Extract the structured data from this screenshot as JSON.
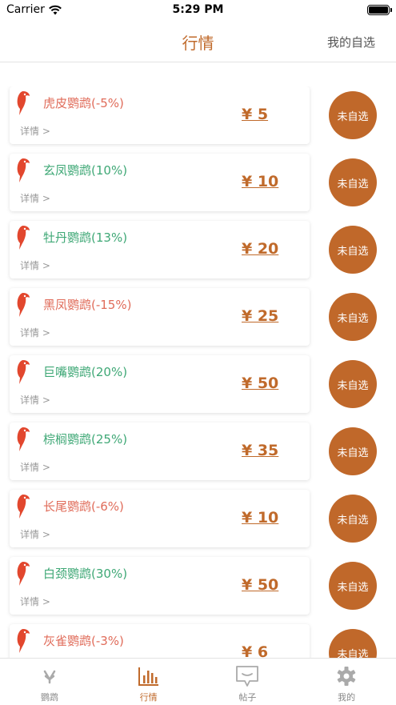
{
  "status_bar": {
    "carrier": "Carrier",
    "time": "5:29 PM"
  },
  "nav": {
    "title": "行情",
    "right_label": "我的自选"
  },
  "colors": {
    "accent": "#c06a2b",
    "up": "#3fa876",
    "down": "#e06c5a",
    "parrot": "#e2472e"
  },
  "items": [
    {
      "name": "虎皮鹦鹉(-5%)",
      "trend": "down",
      "detail": "详情 >",
      "price": "¥ 5",
      "fav": "未自选"
    },
    {
      "name": "玄凤鹦鹉(10%)",
      "trend": "up",
      "detail": "详情 >",
      "price": "¥ 10",
      "fav": "未自选"
    },
    {
      "name": "牡丹鹦鹉(13%)",
      "trend": "up",
      "detail": "详情 >",
      "price": "¥ 20",
      "fav": "未自选"
    },
    {
      "name": "黑凤鹦鹉(-15%)",
      "trend": "down",
      "detail": "详情 >",
      "price": "¥ 25",
      "fav": "未自选"
    },
    {
      "name": "巨嘴鹦鹉(20%)",
      "trend": "up",
      "detail": "详情 >",
      "price": "¥ 50",
      "fav": "未自选"
    },
    {
      "name": "棕榈鹦鹉(25%)",
      "trend": "up",
      "detail": "详情 >",
      "price": "¥ 35",
      "fav": "未自选"
    },
    {
      "name": "长尾鹦鹉(-6%)",
      "trend": "down",
      "detail": "详情 >",
      "price": "¥ 10",
      "fav": "未自选"
    },
    {
      "name": "白颈鹦鹉(30%)",
      "trend": "up",
      "detail": "详情 >",
      "price": "¥ 50",
      "fav": "未自选"
    },
    {
      "name": "灰雀鹦鹉(-3%)",
      "trend": "down",
      "detail": "",
      "price": "¥ 6",
      "fav": "未自选"
    }
  ],
  "tabs": [
    {
      "label": "鹦鹉",
      "icon": "parrot-tab-icon",
      "active": false
    },
    {
      "label": "行情",
      "icon": "chart-icon",
      "active": true
    },
    {
      "label": "帖子",
      "icon": "chat-bubble-icon",
      "active": false
    },
    {
      "label": "我的",
      "icon": "gear-icon",
      "active": false
    }
  ]
}
